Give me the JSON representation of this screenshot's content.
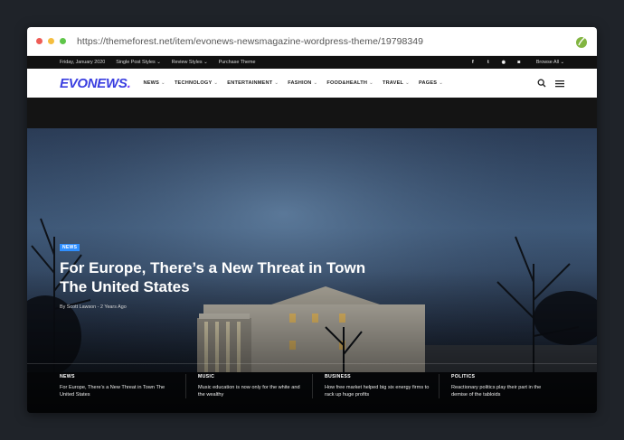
{
  "browser": {
    "url": "https://themeforest.net/item/evonews-newsmagazine-wordpress-theme/19798349",
    "dots": [
      "#ee5c56",
      "#f5be3f",
      "#5fc64a"
    ],
    "leaf_color": "#82b541"
  },
  "topbar": {
    "date": "Friday, January 2020",
    "items": [
      "Single Post Styles ⌄",
      "Review Styles ⌄",
      "Purchase Theme"
    ],
    "social": [
      "f",
      "t",
      "◉",
      "◙"
    ],
    "browse": "Browse All ⌄"
  },
  "navbar": {
    "logo": "EVONEWS",
    "logo_dot": ".",
    "menu": [
      {
        "label": "NEWS",
        "chev": "⌄"
      },
      {
        "label": "TECHNOLOGY",
        "chev": "⌄"
      },
      {
        "label": "ENTERTAINMENT",
        "chev": "⌄"
      },
      {
        "label": "FASHION",
        "chev": "⌄"
      },
      {
        "label": "FOOD&HEALTH",
        "chev": "⌄"
      },
      {
        "label": "TRAVEL",
        "chev": "⌄"
      },
      {
        "label": "PAGES",
        "chev": "⌄"
      }
    ]
  },
  "hero": {
    "badge": "NEWS",
    "title": "For Europe, There’s a New Threat in Town The United States",
    "meta": "By Scott Lawson - 2 Years Ago"
  },
  "bottom": [
    {
      "category": "NEWS",
      "text": "For Europe, There’s a New Threat in Town The United States"
    },
    {
      "category": "MUSIC",
      "text": "Music education is now only for the white and the wealthy"
    },
    {
      "category": "BUSINESS",
      "text": "How free market helped big six energy firms to rack up huge profits"
    },
    {
      "category": "POLITICS",
      "text": "Reactionary politics play their part in the demise of the tabloids"
    }
  ]
}
